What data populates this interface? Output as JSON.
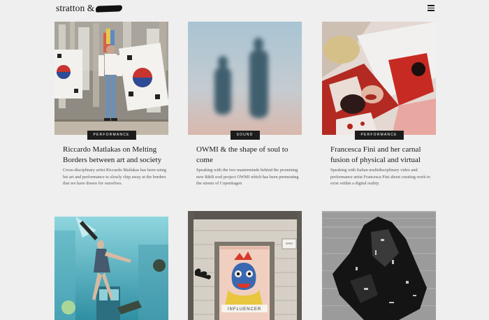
{
  "header": {
    "logo_text": "stratton &"
  },
  "articles": [
    {
      "category": "Performance",
      "title": "Riccardo Matlakas on Melting Borders between art and society",
      "excerpt": "Cross-disciplinary artist Riccardo Matlakas has been using his art and performance to slowly chip away at the borders that we have drawn for ourselves."
    },
    {
      "category": "Sound",
      "title": "OWMI & the shape of soul to come",
      "excerpt": "Speaking with the two masterminds behind the promising new R&B soul project OWMI which has been permeating the streets of Copenhagen"
    },
    {
      "category": "Performance",
      "title": "Francesca Fini and her carnal fusion of physical and virtual",
      "excerpt": "Speaking with Italian multidisciplinary video and performance artist Francesca Fini about creating work to exist within a digital reality."
    },
    {
      "image_text_1": "ESPACE",
      "image_text_2": "INFLUENCER"
    }
  ]
}
